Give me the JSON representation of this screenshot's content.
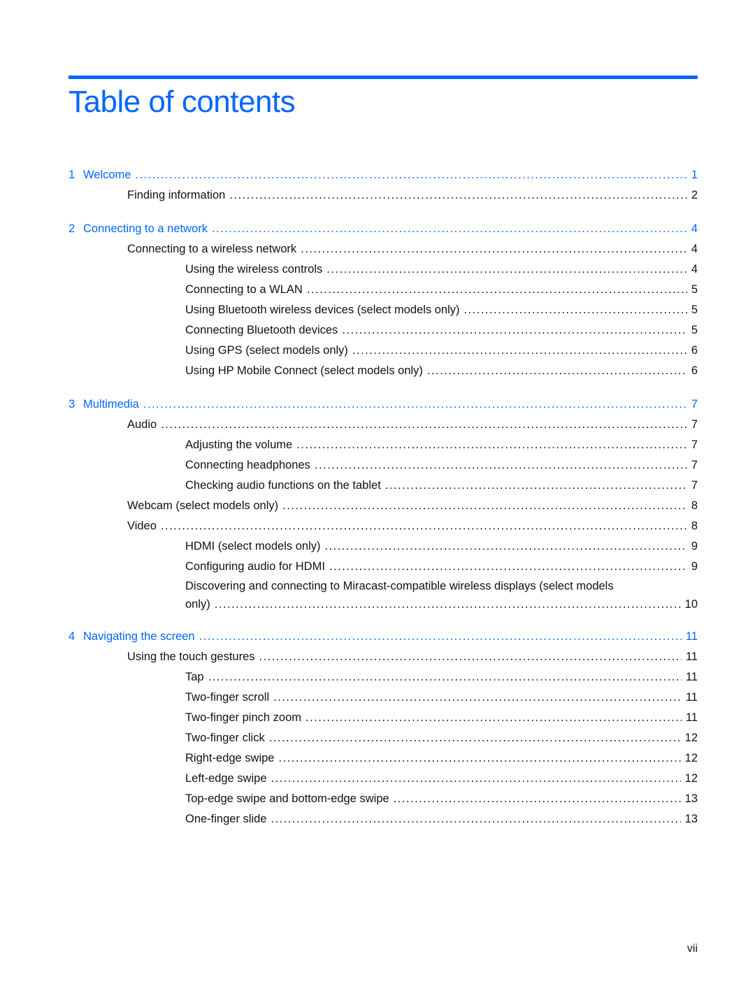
{
  "header": {
    "title": "Table of contents",
    "accent_color": "#0066ff"
  },
  "chapters": [
    {
      "number": "1",
      "title": "Welcome",
      "page": "1",
      "entries": [
        {
          "level": 1,
          "label": "Finding information",
          "page": "2"
        }
      ]
    },
    {
      "number": "2",
      "title": "Connecting to a network",
      "page": "4",
      "entries": [
        {
          "level": 1,
          "label": "Connecting to a wireless network",
          "page": "4"
        },
        {
          "level": 2,
          "label": "Using the wireless controls",
          "page": "4"
        },
        {
          "level": 2,
          "label": "Connecting to a WLAN",
          "page": "5"
        },
        {
          "level": 2,
          "label": "Using Bluetooth wireless devices (select models only)",
          "page": "5"
        },
        {
          "level": 2,
          "label": "Connecting Bluetooth devices",
          "page": "5"
        },
        {
          "level": 2,
          "label": "Using GPS (select models only)",
          "page": "6"
        },
        {
          "level": 2,
          "label": "Using HP Mobile Connect (select models only)",
          "page": "6"
        }
      ]
    },
    {
      "number": "3",
      "title": "Multimedia",
      "page": "7",
      "entries": [
        {
          "level": 1,
          "label": "Audio",
          "page": "7"
        },
        {
          "level": 2,
          "label": "Adjusting the volume",
          "page": "7"
        },
        {
          "level": 2,
          "label": "Connecting headphones",
          "page": "7"
        },
        {
          "level": 2,
          "label": "Checking audio functions on the tablet",
          "page": "7"
        },
        {
          "level": 1,
          "label": "Webcam (select models only)",
          "page": "8"
        },
        {
          "level": 1,
          "label": "Video",
          "page": "8"
        },
        {
          "level": 2,
          "label": "HDMI (select models only)",
          "page": "9"
        },
        {
          "level": 2,
          "label": "Configuring audio for HDMI",
          "page": "9"
        },
        {
          "level": 2,
          "label": "Discovering and connecting to Miracast-compatible wireless displays (select models",
          "label_cont": "only)",
          "page": "10"
        }
      ]
    },
    {
      "number": "4",
      "title": "Navigating the screen",
      "page": "11",
      "entries": [
        {
          "level": 1,
          "label": "Using the touch gestures",
          "page": "11"
        },
        {
          "level": 2,
          "label": "Tap",
          "page": "11"
        },
        {
          "level": 2,
          "label": "Two-finger scroll",
          "page": "11"
        },
        {
          "level": 2,
          "label": "Two-finger pinch zoom",
          "page": "11"
        },
        {
          "level": 2,
          "label": "Two-finger click",
          "page": "12"
        },
        {
          "level": 2,
          "label": "Right-edge swipe",
          "page": "12"
        },
        {
          "level": 2,
          "label": "Left-edge swipe",
          "page": "12"
        },
        {
          "level": 2,
          "label": "Top-edge swipe and bottom-edge swipe",
          "page": "13"
        },
        {
          "level": 2,
          "label": "One-finger slide",
          "page": "13"
        }
      ]
    }
  ],
  "footer": {
    "page_number": "vii"
  }
}
